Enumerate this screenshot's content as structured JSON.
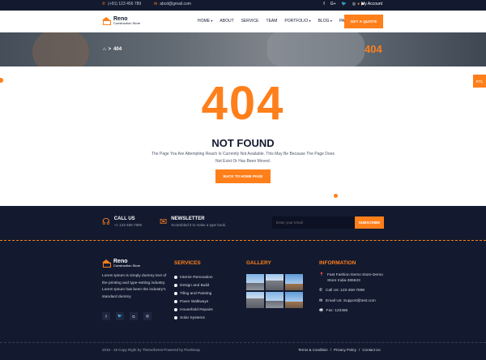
{
  "topbar": {
    "phone": "(+91) 123 456 789",
    "email": "abcd@gmail.com",
    "socials": [
      "f",
      "G+",
      "🐦",
      "◎",
      "▶"
    ],
    "account_label": "My Account"
  },
  "header": {
    "logo_name": "Reno",
    "logo_tag": "Construction Store",
    "nav": [
      {
        "label": "HOME",
        "caret": "▾"
      },
      {
        "label": "ABOUT",
        "caret": ""
      },
      {
        "label": "SERVICE",
        "caret": ""
      },
      {
        "label": "TEAM",
        "caret": ""
      },
      {
        "label": "PORTFOLIO",
        "caret": "▾"
      },
      {
        "label": "BLOG",
        "caret": "▾"
      },
      {
        "label": "PAGE",
        "caret": "▾"
      }
    ],
    "quote_button": "GET A QUOTE"
  },
  "hero": {
    "breadcrumb_home": "⌂",
    "breadcrumb_sep": ">",
    "breadcrumb_current": "404",
    "title": "404"
  },
  "error": {
    "code": "404",
    "heading": "NOT FOUND",
    "description": "The Page You Are Attempting Reach Is Currently Not Available. This May Be Because The Page Does Not Exist Or Has Been Moved.",
    "button": "BACK TO HOME PAGE",
    "rtl_label": "RTL"
  },
  "footer": {
    "call_title": "CALL US",
    "call_number": "+1 123-456-7890",
    "newsletter_title": "NEWSLETTER",
    "newsletter_sub": "Scrambled it to make a type book.",
    "email_placeholder": "Enter your email",
    "subscribe": "SUBSCRIBE",
    "logo_name": "Reno",
    "logo_tag": "Construction Store",
    "about": "Lorem Ipsum is simply dummy text of the printing and type-setting industry. Lorem Ipsum has been the industry's standard dummy",
    "socials": [
      "f",
      "🐦",
      "G",
      "◎"
    ],
    "services_title": "SERVICES",
    "services": [
      "Interior Renovation",
      "Design and Build",
      "Tiling and Painting",
      "Paver Walkways",
      "Household Repairs",
      "Solar Systems"
    ],
    "gallery_title": "GALLERY",
    "information_title": "INFORMATION",
    "info": [
      {
        "icon": "📍",
        "text": "Fast Fashion Demo Store Demo Store India-365623"
      },
      {
        "icon": "✆",
        "text": "Call Us: 123-456-7898"
      },
      {
        "icon": "✉",
        "text": "Email Us: Support@test.com"
      },
      {
        "icon": "🖷",
        "text": "Fax: 123456"
      }
    ],
    "copyright": "2018 - 19 Copy Right by Themeforest Powered by Pixelstrap",
    "legal": [
      "Terms & Condition",
      "/",
      "Privacy Policy",
      "/",
      "Contact Us"
    ]
  },
  "colors": {
    "accent": "#ff7f1a",
    "dark": "#131a2f"
  }
}
